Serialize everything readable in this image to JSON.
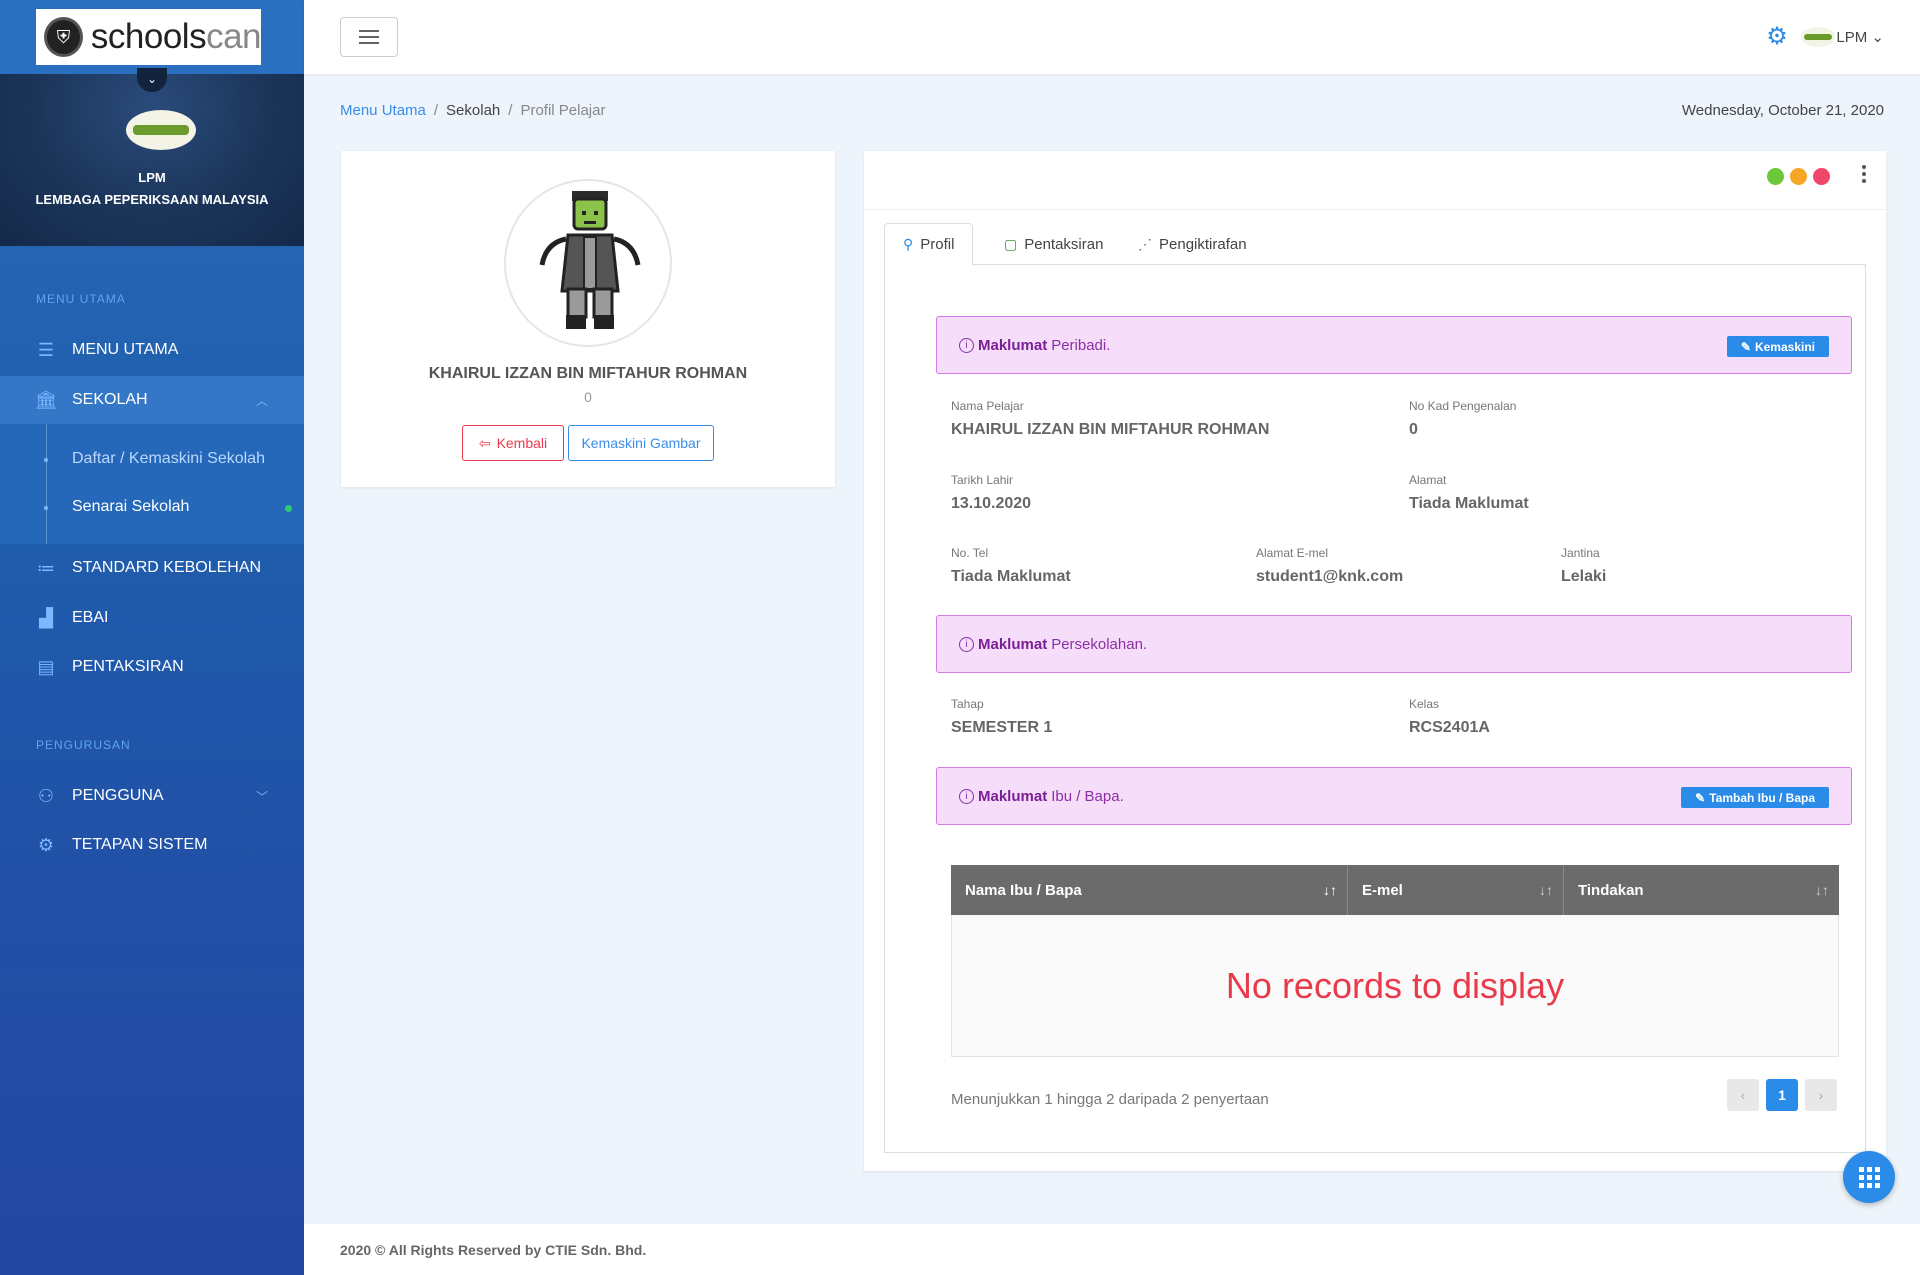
{
  "logo": {
    "brand_dark": "schools",
    "brand_light": "can"
  },
  "sidebar": {
    "org_short": "LPM",
    "org_name": "LEMBAGA PEPERIKSAAN MALAYSIA",
    "section_main": "MENU UTAMA",
    "section_admin": "PENGURUSAN",
    "items": [
      {
        "label": "MENU UTAMA",
        "icon": "list-icon"
      },
      {
        "label": "SEKOLAH",
        "icon": "school-icon"
      },
      {
        "label": "STANDARD KEBOLEHAN",
        "icon": "list-bullets-icon"
      },
      {
        "label": "EBAI",
        "icon": "bar-chart-icon"
      },
      {
        "label": "PENTAKSIRAN",
        "icon": "clipboard-icon"
      },
      {
        "label": "PENGGUNA",
        "icon": "users-icon"
      },
      {
        "label": "TETAPAN SISTEM",
        "icon": "settings-icon"
      }
    ],
    "subitems": [
      {
        "label": "Daftar / Kemaskini Sekolah"
      },
      {
        "label": "Senarai Sekolah"
      }
    ]
  },
  "header": {
    "user": "LPM"
  },
  "breadcrumb": {
    "home": "Menu Utama",
    "parent": "Sekolah",
    "current": "Profil Pelajar"
  },
  "date": "Wednesday, October 21, 2020",
  "student_card": {
    "name": "KHAIRUL IZZAN BIN MIFTAHUR ROHMAN",
    "id": "0",
    "back_label": "Kembali",
    "update_photo_label": "Kemaskini Gambar"
  },
  "tabs": [
    {
      "label": "Profil"
    },
    {
      "label": "Pentaksiran"
    },
    {
      "label": "Pengiktirafan"
    }
  ],
  "personal": {
    "banner_bold": "Maklumat",
    "banner_rest": "Peribadi.",
    "edit_label": "Kemaskini",
    "fields": {
      "nama_label": "Nama Pelajar",
      "nama": "KHAIRUL IZZAN BIN MIFTAHUR ROHMAN",
      "ic_label": "No Kad Pengenalan",
      "ic": "0",
      "dob_label": "Tarikh Lahir",
      "dob": "13.10.2020",
      "address_label": "Alamat",
      "address": "Tiada Maklumat",
      "tel_label": "No. Tel",
      "tel": "Tiada Maklumat",
      "email_label": "Alamat E-mel",
      "email": "student1@knk.com",
      "gender_label": "Jantina",
      "gender": "Lelaki"
    }
  },
  "school": {
    "banner_bold": "Maklumat",
    "banner_rest": "Persekolahan.",
    "level_label": "Tahap",
    "level": "SEMESTER 1",
    "class_label": "Kelas",
    "class": "RCS2401A"
  },
  "parents": {
    "banner_bold": "Maklumat",
    "banner_rest": "Ibu / Bapa.",
    "add_label": "Tambah Ibu / Bapa",
    "columns": [
      "Nama Ibu / Bapa",
      "E-mel",
      "Tindakan"
    ],
    "empty": "No records to display",
    "summary": "Menunjukkan 1 hingga 2 daripada 2 penyertaan",
    "page": "1"
  },
  "footer": "2020 © All Rights Reserved by CTIE Sdn. Bhd.",
  "colors": {
    "accent": "#2a8be8",
    "danger": "#e83a4a",
    "banner_bg": "#f6ddfa",
    "banner_border": "#d67ae6"
  }
}
